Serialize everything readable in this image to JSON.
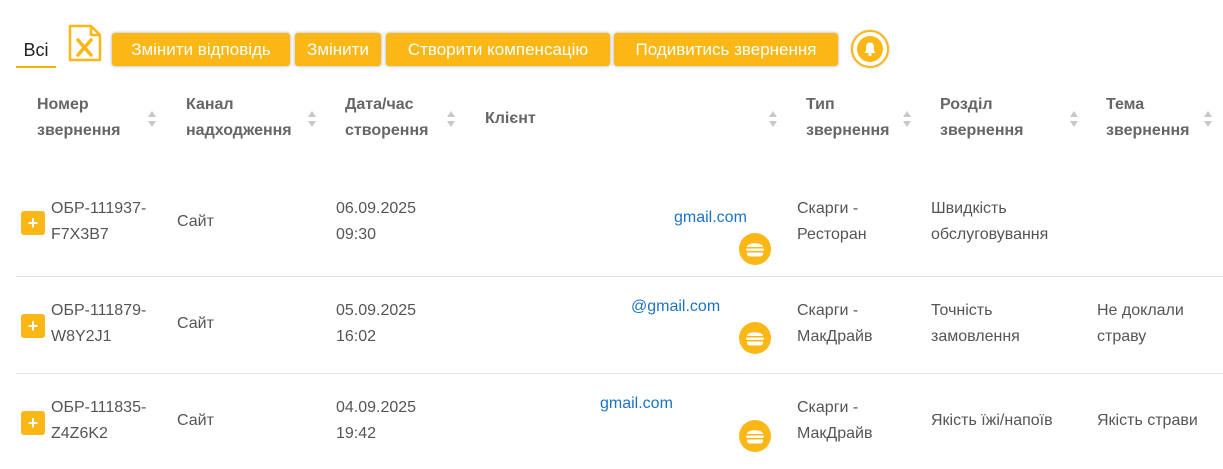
{
  "toolbar": {
    "tab_all": "Всі",
    "excel_icon": "excel-export-icon",
    "btn_answer": "Змінити відповідь",
    "btn_edit": "Змінити",
    "btn_compensation": "Створити компенсацію",
    "btn_view": "Подивитись звернення",
    "bell_icon": "bell-icon"
  },
  "colors": {
    "accent": "#fbb716",
    "link": "#1a73c9",
    "text": "#555555",
    "header": "#666666"
  },
  "columns": {
    "number": [
      "Номер",
      "звернення"
    ],
    "channel": [
      "Канал",
      "надходження"
    ],
    "created": [
      "Дата/час",
      "створення"
    ],
    "client": "Клієнт",
    "type": [
      "Тип",
      "звернення"
    ],
    "section": [
      "Розділ",
      "звернення"
    ],
    "topic": [
      "Тема",
      "звернення"
    ]
  },
  "rows": [
    {
      "number": [
        "ОБР-111937-",
        "F7X3B7"
      ],
      "channel": "Сайт",
      "created": [
        "06.09.2025",
        "09:30"
      ],
      "email": "gmail.com",
      "type": [
        "Скарги -",
        "Ресторан"
      ],
      "section": [
        "Швидкість",
        "обслуговування"
      ],
      "topic": []
    },
    {
      "number": [
        "ОБР-111879-",
        "W8Y2J1"
      ],
      "channel": "Сайт",
      "created": [
        "05.09.2025",
        "16:02"
      ],
      "email": "@gmail.com",
      "type": [
        "Скарги -",
        "МакДрайв"
      ],
      "section": [
        "Точність",
        "замовлення"
      ],
      "topic": [
        "Не доклали",
        "страву"
      ]
    },
    {
      "number": [
        "ОБР-111835-",
        "Z4Z6K2"
      ],
      "channel": "Сайт",
      "created": [
        "04.09.2025",
        "19:42"
      ],
      "email": "gmail.com",
      "type": [
        "Скарги -",
        "МакДрайв"
      ],
      "section": [
        "Якість їжі/напоїв"
      ],
      "topic": [
        "Якість страви"
      ]
    }
  ]
}
